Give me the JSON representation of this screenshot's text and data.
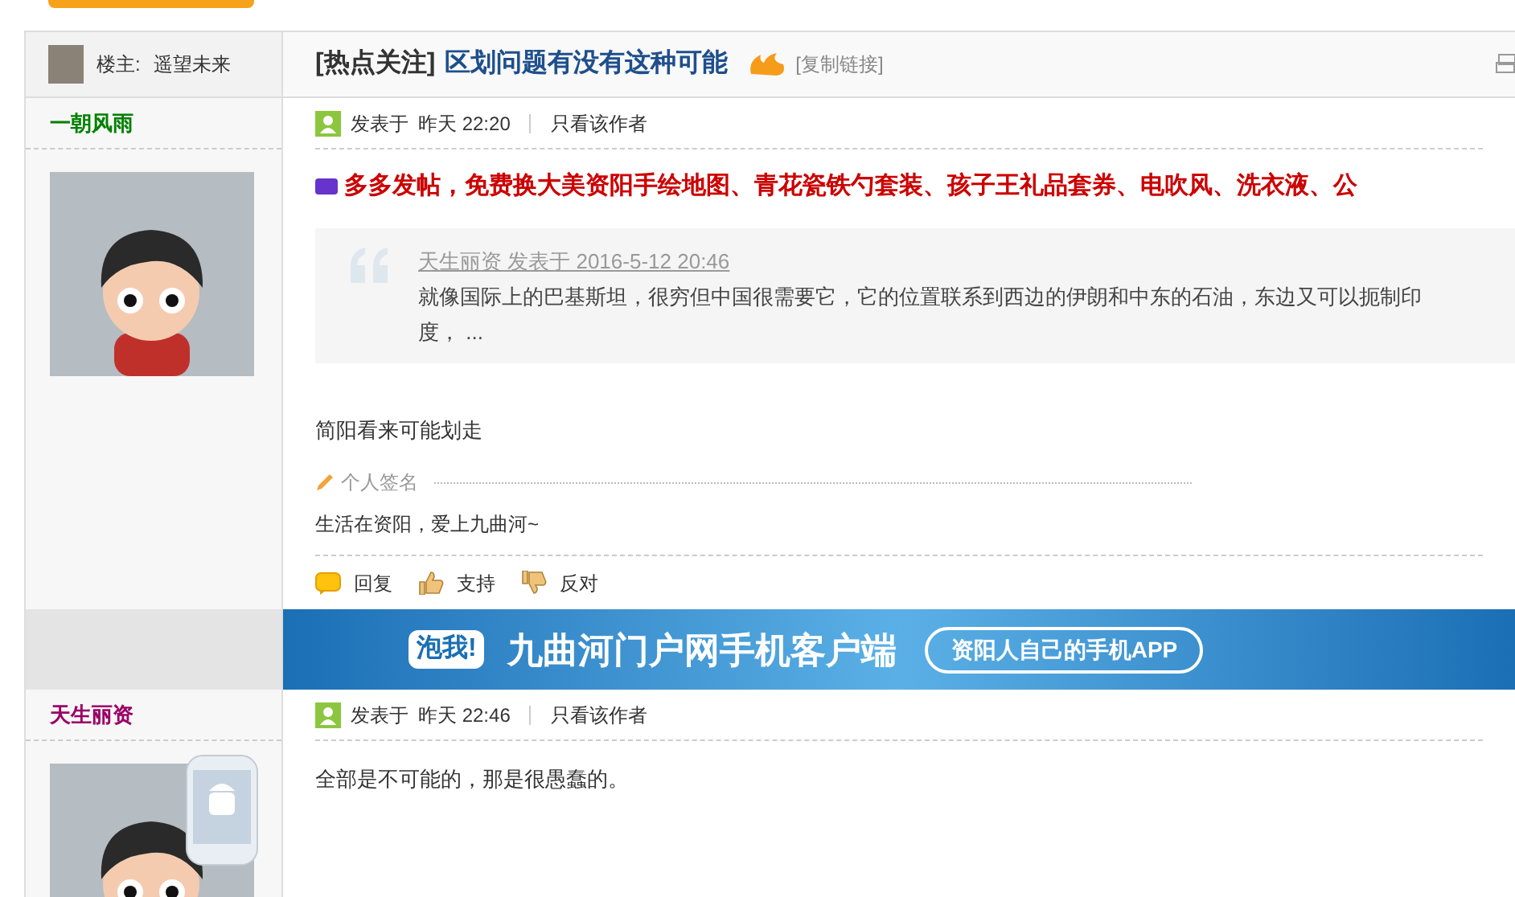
{
  "thread": {
    "author_label": "楼主:",
    "author": "遥望未来",
    "tag": "[热点关注]",
    "title": "区划问题有没有这种可能",
    "copy_link": "[复制链接]"
  },
  "sections": [
    {
      "kind": "post",
      "username": "一朝风雨",
      "color": "#008000",
      "mobile": false,
      "posted": "发表于",
      "time": "昨天 22:20",
      "author_only": "只看该作者",
      "ad": "多多发帖，免费换大美资阳手绘地图、青花瓷铁勺套装、孩子王礼品套券、电吹风、洗衣液、公",
      "quote": {
        "meta": "天生丽资 发表于 2016-5-12 20:46",
        "text": "就像国际上的巴基斯坦，很穷但中国很需要它，它的位置联系到西边的伊朗和中东的石油，东边又可以扼制印度，  ..."
      },
      "body": "简阳看来可能划走",
      "signature": {
        "label": "个人签名",
        "text": "生活在资阳，爱上九曲河~"
      },
      "actions": [
        {
          "kind": "reply",
          "label": "回复"
        },
        {
          "kind": "support",
          "label": "支持"
        },
        {
          "kind": "oppose",
          "label": "反对"
        }
      ]
    },
    {
      "kind": "banner",
      "badge": "泡我!",
      "title": "九曲河门户网手机客户端",
      "slogan": "资阳人自己的手机APP"
    },
    {
      "kind": "post",
      "username": "天生丽资",
      "color": "#990066",
      "mobile": true,
      "posted": "发表于",
      "time": "昨天 22:46",
      "author_only": "只看该作者",
      "body": "全部是不可能的，那是很愚蠢的。"
    }
  ]
}
